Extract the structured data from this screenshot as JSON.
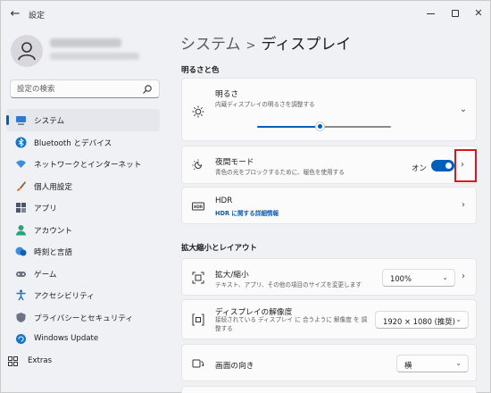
{
  "window": {
    "title": "設定"
  },
  "search": {
    "placeholder": "設定の検索"
  },
  "user": {
    "name": "████ ████",
    "email": "████████████"
  },
  "sidebar": {
    "items": [
      {
        "label": "システム",
        "icon": "system-icon",
        "active": true
      },
      {
        "label": "Bluetooth とデバイス",
        "icon": "bluetooth-icon"
      },
      {
        "label": "ネットワークとインターネット",
        "icon": "wifi-icon"
      },
      {
        "label": "個人用設定",
        "icon": "brush-icon"
      },
      {
        "label": "アプリ",
        "icon": "apps-icon"
      },
      {
        "label": "アカウント",
        "icon": "account-icon"
      },
      {
        "label": "時刻と言語",
        "icon": "time-language-icon"
      },
      {
        "label": "ゲーム",
        "icon": "gaming-icon"
      },
      {
        "label": "アクセシビリティ",
        "icon": "accessibility-icon"
      },
      {
        "label": "プライバシーとセキュリティ",
        "icon": "shield-icon"
      },
      {
        "label": "Windows Update",
        "icon": "update-icon"
      },
      {
        "label": "Extras",
        "icon": "extras-icon"
      }
    ]
  },
  "breadcrumb": {
    "parent": "システム",
    "separator": ">",
    "current": "ディスプレイ"
  },
  "sections": {
    "brightness_color": "明るさと色",
    "scale_layout": "拡大縮小とレイアウト"
  },
  "brightness": {
    "title": "明るさ",
    "subtitle": "内蔵ディスプレイの明るさを調整する",
    "value_fraction": 0.47
  },
  "night_light": {
    "title": "夜間モード",
    "subtitle": "青色の光をブロックするために、暖色を使用する",
    "state_label": "オン",
    "on": true
  },
  "hdr": {
    "title": "HDR",
    "link": "HDR に関する詳細情報"
  },
  "scale": {
    "title": "拡大/縮小",
    "subtitle": "テキスト、アプリ、その他の項目のサイズを変更します",
    "value": "100%"
  },
  "resolution": {
    "title": "ディスプレイの解像度",
    "subtitle": "接続されている ディスプレイ に 合うように 解像度 を 調整する",
    "value": "1920 × 1080 (推奨)"
  },
  "orientation": {
    "title": "画面の向き",
    "value": "横"
  },
  "colors": {
    "accent": "#005fb8",
    "highlight": "#e0121b"
  }
}
